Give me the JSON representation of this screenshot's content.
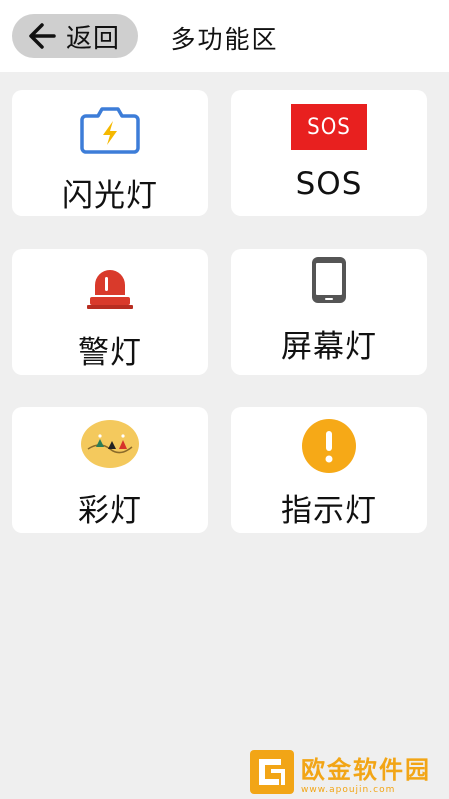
{
  "header": {
    "back_label": "返回",
    "title": "多功能区"
  },
  "cards": [
    {
      "label": "闪光灯",
      "icon": "camera-flash-icon"
    },
    {
      "label": "SOS",
      "icon": "sos-icon",
      "badge": "SOS"
    },
    {
      "label": "警灯",
      "icon": "siren-icon"
    },
    {
      "label": "屏幕灯",
      "icon": "phone-icon"
    },
    {
      "label": "彩灯",
      "icon": "color-lights-icon"
    },
    {
      "label": "指示灯",
      "icon": "exclamation-icon"
    }
  ],
  "colors": {
    "flash_blue": "#3d7dd8",
    "flash_yellow": "#f5b800",
    "sos_red": "#e8201f",
    "siren_red": "#d93a2b",
    "phone_gray": "#555555",
    "indicator_yellow": "#f6a917",
    "watermark_orange": "#f2a516"
  },
  "watermark": {
    "title": "欧金软件园",
    "url": "www.apoujin.com"
  }
}
